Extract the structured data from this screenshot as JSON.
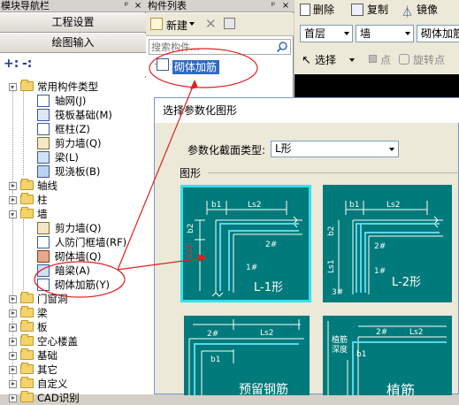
{
  "navigator": {
    "title": "模块导航栏",
    "pin_glyph": "ᵖ",
    "close_glyph": "×",
    "buttons": [
      "工程设置",
      "绘图输入"
    ],
    "toolbar": {
      "expand_all": "+:",
      "collapse_all": "-:"
    },
    "tree": [
      {
        "label": "常用构件类型",
        "kind": "folder",
        "state": "open"
      },
      {
        "label": "轴网(J)",
        "kind": "item"
      },
      {
        "label": "筏板基础(M)",
        "kind": "item"
      },
      {
        "label": "框柱(Z)",
        "kind": "item"
      },
      {
        "label": "剪力墙(Q)",
        "kind": "item"
      },
      {
        "label": "梁(L)",
        "kind": "item"
      },
      {
        "label": "现浇板(B)",
        "kind": "item"
      },
      {
        "label": "轴线",
        "kind": "folder",
        "state": "closed"
      },
      {
        "label": "柱",
        "kind": "folder",
        "state": "closed"
      },
      {
        "label": "墙",
        "kind": "folder",
        "state": "open"
      },
      {
        "label": "剪力墙(Q)",
        "kind": "item"
      },
      {
        "label": "人防门框墙(RF)",
        "kind": "item"
      },
      {
        "label": "砌体墙(Q)",
        "kind": "item"
      },
      {
        "label": "暗梁(A)",
        "kind": "item"
      },
      {
        "label": "砌体加筋(Y)",
        "kind": "item"
      },
      {
        "label": "门窗洞",
        "kind": "folder",
        "state": "closed"
      },
      {
        "label": "梁",
        "kind": "folder",
        "state": "closed"
      },
      {
        "label": "板",
        "kind": "folder",
        "state": "closed"
      },
      {
        "label": "空心楼盖",
        "kind": "folder",
        "state": "closed"
      },
      {
        "label": "基础",
        "kind": "folder",
        "state": "closed"
      },
      {
        "label": "其它",
        "kind": "folder",
        "state": "closed"
      },
      {
        "label": "自定义",
        "kind": "folder",
        "state": "closed"
      },
      {
        "label": "CAD识别",
        "kind": "folder",
        "state": "closed"
      }
    ]
  },
  "component_list": {
    "title": "构件列表",
    "new_label": "新建",
    "search": {
      "placeholder": "搜索构件..."
    },
    "items": [
      {
        "label": "砌体加筋",
        "selected": true
      }
    ]
  },
  "ribbon": {
    "delete_label": "删除",
    "copy_label": "复制",
    "mirror_label": "镜像",
    "floor_value": "首层",
    "type_value": "墙",
    "component_value": "砌体加筋",
    "select_label": "选择",
    "point_label": "点",
    "rotate_point_label": "旋转点"
  },
  "dialog": {
    "title": "选择参数化图形",
    "section_type_label": "参数化截面类型:",
    "section_type_value": "L形",
    "group_label": "图形",
    "shapes": [
      {
        "name": "L-1形",
        "selected": true,
        "tags": [
          "b1",
          "Ls2",
          "2#",
          "1#",
          "Ls1",
          "b2"
        ]
      },
      {
        "name": "L-2形",
        "selected": false,
        "tags": [
          "b1",
          "Ls2",
          "2#",
          "1#",
          "3#",
          "Ls1",
          "b2"
        ]
      },
      {
        "name": "预留钢筋",
        "selected": false,
        "tags": [
          "2#",
          "Ls2",
          "b1"
        ]
      },
      {
        "name": "植筋",
        "selected": false,
        "tags": [
          "植筋",
          "深度",
          "2#",
          "Ls2",
          "b1"
        ]
      }
    ]
  },
  "colors": {
    "panel_bg": "#d4d0c8",
    "selection": "#316ac5",
    "shape_bg": "#007a7a",
    "shape_selected_outline": "#35e0ea",
    "shape_line": "#ffffff",
    "annotation": "#e02020"
  }
}
